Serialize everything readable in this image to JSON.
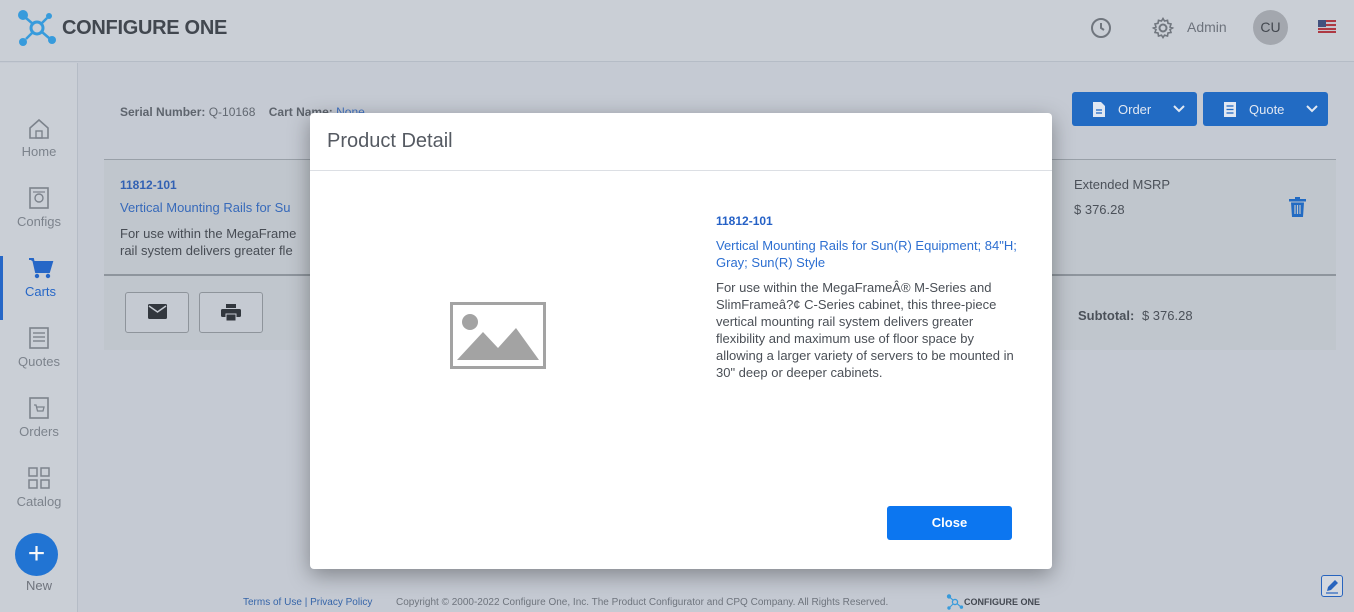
{
  "header": {
    "brand": "CONFIGURE ONE",
    "user_label": "Admin",
    "avatar_initials": "CU"
  },
  "sidebar": {
    "items": [
      {
        "label": "Home",
        "icon": "home-icon"
      },
      {
        "label": "Configs",
        "icon": "configs-icon"
      },
      {
        "label": "Carts",
        "icon": "cart-icon",
        "active": true
      },
      {
        "label": "Quotes",
        "icon": "quotes-icon"
      },
      {
        "label": "Orders",
        "icon": "orders-icon"
      },
      {
        "label": "Catalog",
        "icon": "catalog-icon"
      }
    ],
    "new_label": "New",
    "new_symbol": "+"
  },
  "cart": {
    "serial_label": "Serial Number:",
    "serial_value": "Q-10168",
    "cart_name_label": "Cart Name:",
    "cart_name_value": "None",
    "order_button": "Order",
    "quote_button": "Quote",
    "item": {
      "part_number": "11812-101",
      "title_truncated": "Vertical Mounting Rails for Su",
      "desc_line1": "For use within the MegaFrame",
      "desc_line2": "rail system delivers greater fle",
      "msrp_label": "Extended MSRP",
      "msrp_value": "$ 376.28"
    },
    "subtotal_label": "Subtotal:",
    "subtotal_value": "$ 376.28"
  },
  "footer": {
    "terms": "Terms of Use",
    "separator": "|",
    "privacy": "Privacy Policy",
    "copyright": "Copyright © 2000-2022 Configure One, Inc. The Product Configurator and CPQ Company. All Rights Reserved.",
    "brand": "CONFIGURE ONE"
  },
  "modal": {
    "title": "Product Detail",
    "part_number": "11812-101",
    "product_title": "Vertical Mounting Rails for Sun(R) Equipment; 84\"H; Gray; Sun(R) Style",
    "description": "For use within the MegaFrameÂ® M-Series and SlimFrameâ?¢ C-Series cabinet, this three-piece vertical mounting rail system delivers greater flexibility and maximum use of floor space by allowing a larger variety of servers to be mounted in 30\" deep or deeper cabinets.",
    "close_label": "Close"
  },
  "colors": {
    "primary": "#0c76f0",
    "link": "#2d6fd1",
    "active_nav": "#1d62c9"
  }
}
